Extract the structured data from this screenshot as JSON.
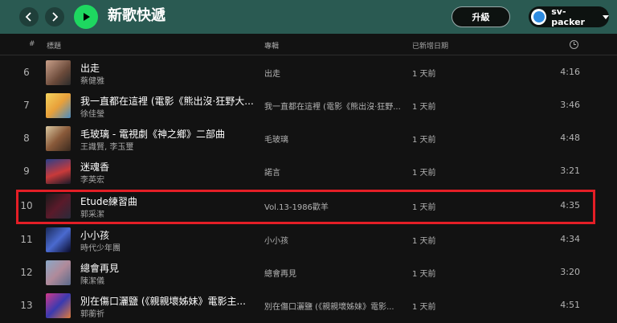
{
  "header": {
    "title": "新歌快遞",
    "upgrade_label": "升級",
    "username": "sv-packer"
  },
  "columns": {
    "index": "#",
    "title": "標題",
    "album": "專輯",
    "date_added": "已新增日期",
    "duration_icon": "clock-icon"
  },
  "tracks": [
    {
      "num": "6",
      "title": "出走",
      "artist": "蔡健雅",
      "album": "出走",
      "date": "1 天前",
      "duration": "4:16"
    },
    {
      "num": "7",
      "title": "我一直都在這裡 (電影《熊出沒·狂野大...",
      "artist": "徐佳瑩",
      "album": "我一直都在這裡 (電影《熊出沒·狂野...",
      "date": "1 天前",
      "duration": "3:46"
    },
    {
      "num": "8",
      "title": "毛玻璃 - 電視劇《神之鄉》二部曲",
      "artist": "王識賢, 李玉璽",
      "album": "毛玻璃",
      "date": "1 天前",
      "duration": "4:48"
    },
    {
      "num": "9",
      "title": "迷魂香",
      "artist": "李英宏",
      "album": "諾言",
      "date": "1 天前",
      "duration": "3:21"
    },
    {
      "num": "10",
      "title": "Etude練習曲",
      "artist": "郭采潔",
      "album": "Vol.13-1986歡羊",
      "date": "1 天前",
      "duration": "4:35"
    },
    {
      "num": "11",
      "title": "小小孩",
      "artist": "時代少年團",
      "album": "小小孩",
      "date": "1 天前",
      "duration": "4:34"
    },
    {
      "num": "12",
      "title": "總會再見",
      "artist": "陳潔儀",
      "album": "總會再見",
      "date": "1 天前",
      "duration": "3:20"
    },
    {
      "num": "13",
      "title": "別在傷口灑鹽 (《親親壞姊妹》電影主...",
      "artist": "郭蘅祈",
      "album": "別在傷口灑鹽 (《親親壞姊妹》電影...",
      "date": "1 天前",
      "duration": "4:51"
    }
  ],
  "colors": {
    "topbar": "#2a5a52",
    "background": "#121212",
    "play_button": "#1ed760",
    "highlight": "#e41e26"
  }
}
